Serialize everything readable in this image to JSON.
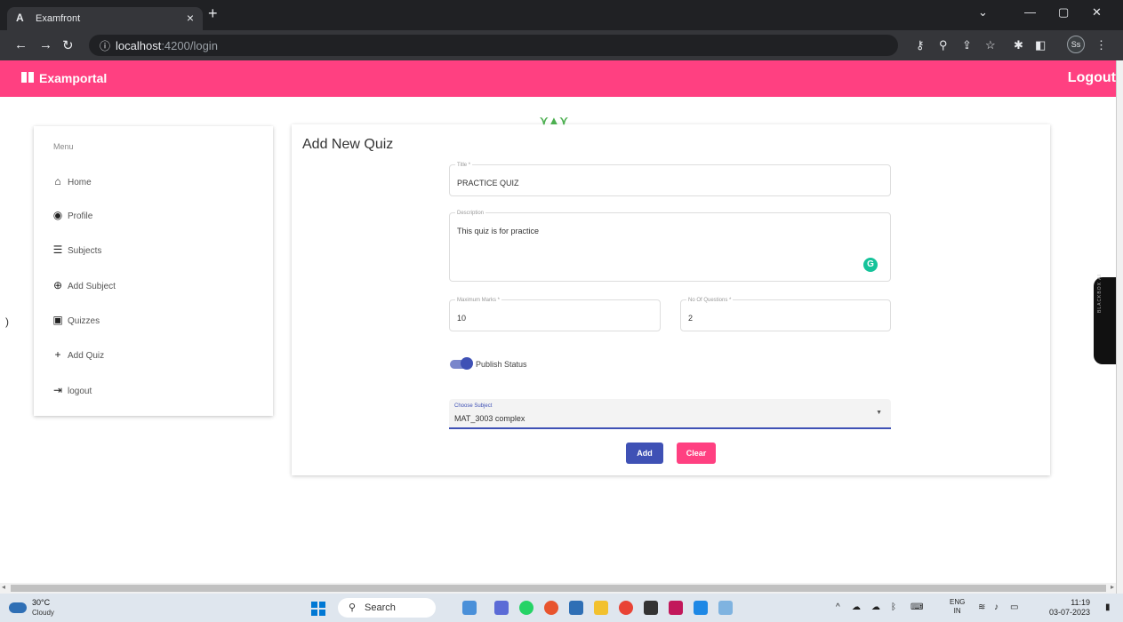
{
  "browser": {
    "tab_title": "Examfront",
    "tab_favicon": "A",
    "url_host": "localhost",
    "url_path": ":4200/login",
    "profile_initials": "Ss"
  },
  "app": {
    "brand": "Examportal",
    "logout": "Logout",
    "accent_color": "#ff4081",
    "primary_color": "#3f51b5"
  },
  "sidebar": {
    "menu_label": "Menu",
    "items": [
      {
        "label": "Home",
        "icon": "home-icon"
      },
      {
        "label": "Profile",
        "icon": "account-circle-icon"
      },
      {
        "label": "Subjects",
        "icon": "list-icon"
      },
      {
        "label": "Add Subject",
        "icon": "add-circle-icon"
      },
      {
        "label": "Quizzes",
        "icon": "quiz-icon"
      },
      {
        "label": "Add Quiz",
        "icon": "plus-icon"
      },
      {
        "label": "logout",
        "icon": "logout-icon"
      }
    ]
  },
  "form": {
    "heading": "Add New Quiz",
    "title_label": "Title *",
    "title_value": "PRACTICE QUIZ",
    "description_label": "Description",
    "description_value": "This quiz is for practice",
    "max_marks_label": "Maximum Marks *",
    "max_marks_value": "10",
    "num_questions_label": "No Of Questions *",
    "num_questions_value": "2",
    "publish_label": "Publish Status",
    "publish_on": true,
    "subject_label": "Choose Subject",
    "subject_value": "MAT_3003 complex",
    "add_button": "Add",
    "clear_button": "Clear"
  },
  "blackbox": {
    "label": "BLACKBOX AI"
  },
  "taskbar": {
    "temperature": "30°C",
    "weather": "Cloudy",
    "search": "Search",
    "lang_1": "ENG",
    "lang_2": "IN",
    "time": "11:19",
    "date": "03-07-2023"
  }
}
